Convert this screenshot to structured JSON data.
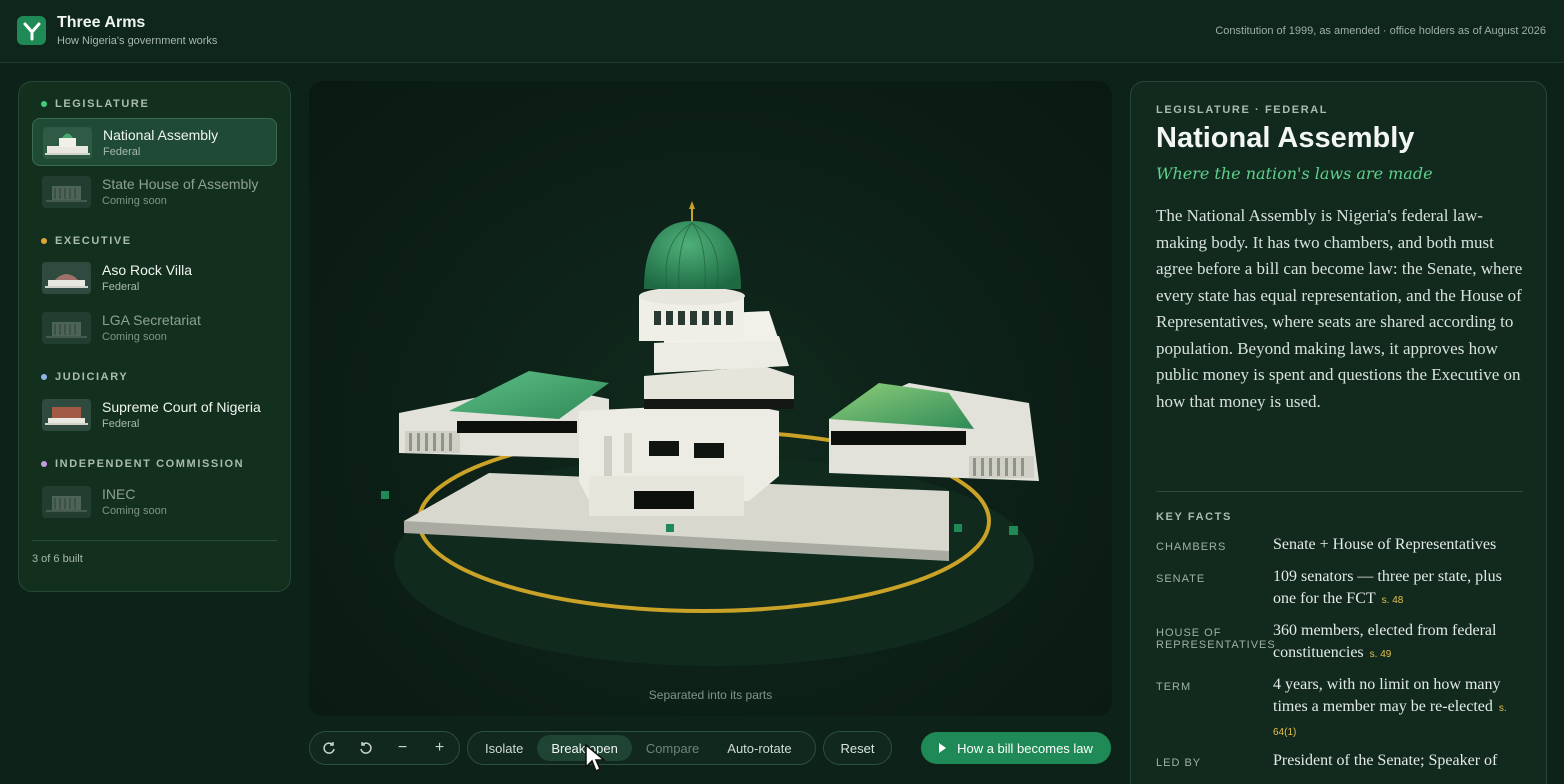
{
  "header": {
    "app_title": "Three Arms",
    "app_subtitle": "How Nigeria's government works",
    "note": "Constitution of 1999, as amended · office holders as of August 2026"
  },
  "sidebar": {
    "sections": [
      {
        "label": "LEGISLATURE",
        "color": "#3fcf7a"
      },
      {
        "label": "EXECUTIVE",
        "color": "#e0a63a"
      },
      {
        "label": "JUDICIARY",
        "color": "#8fb3e6"
      },
      {
        "label": "INDEPENDENT COMMISSION",
        "color": "#c79be0"
      }
    ],
    "items": [
      {
        "label": "National Assembly",
        "meta": "Federal"
      },
      {
        "label": "State House of Assembly",
        "meta": "Coming soon"
      },
      {
        "label": "Aso Rock Villa",
        "meta": "Federal"
      },
      {
        "label": "LGA Secretariat",
        "meta": "Coming soon"
      },
      {
        "label": "Supreme Court of Nigeria",
        "meta": "Federal"
      },
      {
        "label": "INEC",
        "meta": "Coming soon"
      }
    ],
    "footer": "3 of 6 built"
  },
  "viewport": {
    "caption": "Separated into its parts"
  },
  "toolbar": {
    "rotate_icon": "rotate-cw-icon",
    "rotate_ccw_icon": "rotate-ccw-icon",
    "zoom_out": "−",
    "zoom_in": "+",
    "modes": [
      "Isolate",
      "Break open",
      "Compare",
      "Auto-rotate"
    ],
    "active_mode": "Break open",
    "reset": "Reset",
    "primary": "How a bill becomes law"
  },
  "detail": {
    "eyebrow": "LEGISLATURE · FEDERAL",
    "title": "National Assembly",
    "tagline": "Where the nation's laws are made",
    "body": "The National Assembly is Nigeria's federal law-making body. It has two chambers, and both must agree before a bill can become law: the Senate, where every state has equal representation, and the House of Representatives, where seats are shared according to population. Beyond making laws, it approves how public money is spent and questions the Executive on how that money is used.",
    "key_facts_label": "KEY FACTS",
    "facts": [
      {
        "key": "CHAMBERS",
        "value": "Senate + House of Representatives",
        "cite": ""
      },
      {
        "key": "SENATE",
        "value": "109 senators — three per state, plus one for the FCT",
        "cite": "s. 48"
      },
      {
        "key": "HOUSE OF REPRESENTATIVES",
        "value": "360 members, elected from federal constituencies",
        "cite": "s. 49"
      },
      {
        "key": "TERM",
        "value": "4 years, with no limit on how many times a member may be re-elected",
        "cite": "s. 64(1)"
      },
      {
        "key": "LED BY",
        "value": "President of the Senate; Speaker of",
        "cite": ""
      }
    ]
  },
  "colors": {
    "accent": "#1f8a55",
    "dome": "#2f8f5e",
    "gold_ring": "#c9a227"
  }
}
